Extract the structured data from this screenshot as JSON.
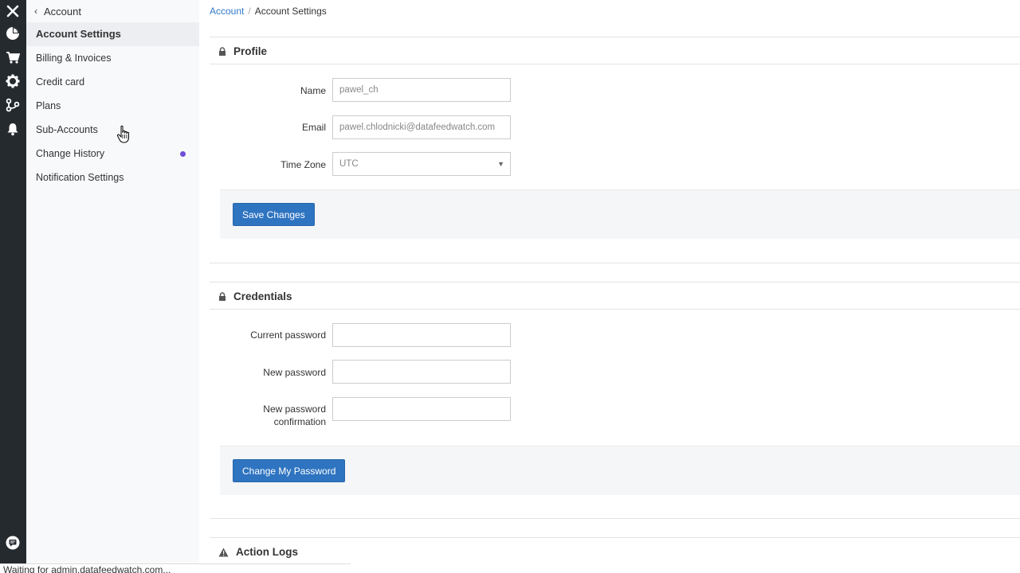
{
  "rail": {
    "icons": [
      "close-icon",
      "pie-chart-icon",
      "cart-icon",
      "gear-icon",
      "flow-icon",
      "bell-icon",
      "chat-icon"
    ]
  },
  "sidebar": {
    "back_label": "Account",
    "items": [
      {
        "label": "Account Settings",
        "active": true
      },
      {
        "label": "Billing & Invoices"
      },
      {
        "label": "Credit card"
      },
      {
        "label": "Plans"
      },
      {
        "label": "Sub-Accounts"
      },
      {
        "label": "Change History",
        "badge": "dot"
      },
      {
        "label": "Notification Settings"
      }
    ]
  },
  "breadcrumb": {
    "parent": "Account",
    "separator": "/",
    "current": "Account Settings"
  },
  "profile": {
    "title": "Profile",
    "name_label": "Name",
    "name_value": "pawel_ch",
    "email_label": "Email",
    "email_value": "pawel.chlodnicki@datafeedwatch.com",
    "timezone_label": "Time Zone",
    "timezone_value": "UTC",
    "save_label": "Save Changes"
  },
  "credentials": {
    "title": "Credentials",
    "current_password_label": "Current password",
    "new_password_label": "New password",
    "confirm_label_line1": "New password",
    "confirm_label_line2": "confirmation",
    "change_label": "Change My Password"
  },
  "action_logs": {
    "title": "Action Logs"
  },
  "status_bar": {
    "text": "Waiting for admin.datafeedwatch.com..."
  },
  "colors": {
    "rail_bg": "#252a2f",
    "accent": "#2e74c0",
    "link": "#3178c6",
    "badge": "#6f4fd8"
  }
}
